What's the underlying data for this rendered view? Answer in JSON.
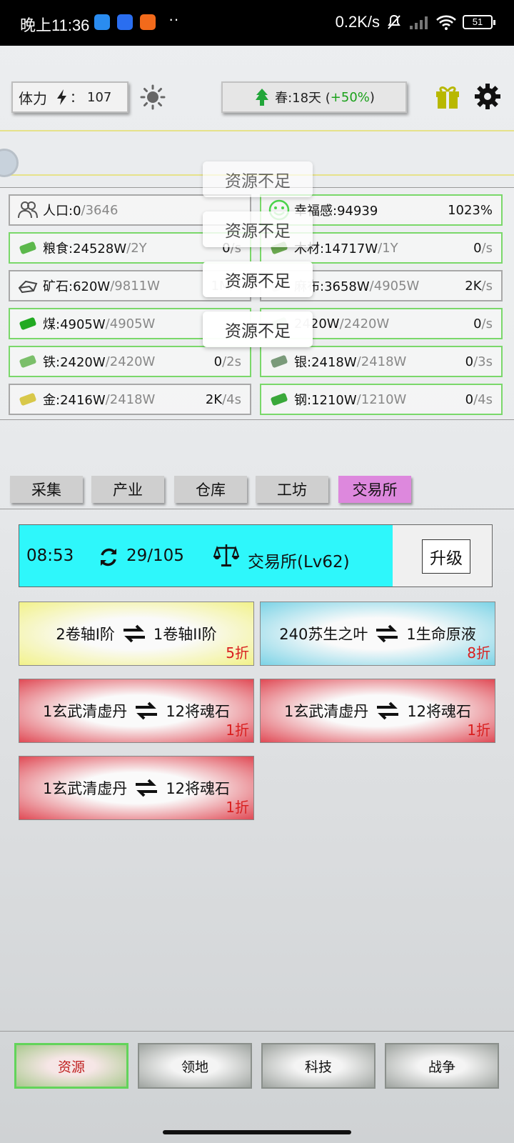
{
  "status_bar": {
    "time": "晚上11:36",
    "dots": "··",
    "net_speed": "0.2K/s",
    "battery": "51"
  },
  "top": {
    "stamina_label": "体力",
    "stamina_sep": "：",
    "stamina_value": "107",
    "season_text": "春:18天 (",
    "season_pct": "+50%",
    "season_close": ")"
  },
  "resources": [
    {
      "name": "人口:0",
      "cap": "/3646",
      "rate": "",
      "unit": "",
      "border": "grey",
      "icon": "people-icon"
    },
    {
      "name": "幸福感:94939",
      "cap": "",
      "rate": "1023%",
      "unit": "",
      "border": "green",
      "icon": "smile-icon"
    },
    {
      "name": "粮食:24528W",
      "cap": "/2Y",
      "rate": "0",
      "unit": "/s",
      "border": "green",
      "icon": "food-icon"
    },
    {
      "name": "木材:14717W",
      "cap": "/1Y",
      "rate": "0",
      "unit": "/s",
      "border": "green",
      "icon": "wood-icon"
    },
    {
      "name": "矿石:620W",
      "cap": "/9811W",
      "rate": "1M",
      "unit": "/s",
      "border": "grey",
      "icon": "ore-icon"
    },
    {
      "name": "麻布:3658W",
      "cap": "/4905W",
      "rate": "2K",
      "unit": "/s",
      "border": "grey",
      "icon": "linen-icon"
    },
    {
      "name": "煤:4905W",
      "cap": "/4905W",
      "rate": "",
      "unit": "",
      "border": "green",
      "icon": "coal-icon"
    },
    {
      "name": "2420W",
      "cap": "/2420W",
      "rate": "0",
      "unit": "/s",
      "border": "green",
      "icon": "copper-icon"
    },
    {
      "name": "铁:2420W",
      "cap": "/2420W",
      "rate": "0",
      "unit": "/2s",
      "border": "green",
      "icon": "iron-icon"
    },
    {
      "name": "银:2418W",
      "cap": "/2418W",
      "rate": "0",
      "unit": "/3s",
      "border": "green",
      "icon": "silver-icon"
    },
    {
      "name": "金:2416W",
      "cap": "/2418W",
      "rate": "2K",
      "unit": "/4s",
      "border": "grey",
      "icon": "gold-icon"
    },
    {
      "name": "钢:1210W",
      "cap": "/1210W",
      "rate": "0",
      "unit": "/4s",
      "border": "green",
      "icon": "steel-icon"
    }
  ],
  "toasts": [
    "资源不足",
    "资源不足",
    "资源不足",
    "资源不足"
  ],
  "tabs": [
    "采集",
    "产业",
    "仓库",
    "工坊",
    "交易所"
  ],
  "exchange": {
    "timer": "08:53",
    "refresh_count": "29/105",
    "title": "交易所(Lv62)",
    "upgrade_label": "升级"
  },
  "trades": [
    {
      "give": "2卷轴I阶",
      "get": "1卷轴II阶",
      "discount": "5折",
      "color": "yellow"
    },
    {
      "give": "240苏生之叶",
      "get": "1生命原液",
      "discount": "8折",
      "color": "blue"
    },
    {
      "give": "1玄武清虚丹",
      "get": "12将魂石",
      "discount": "1折",
      "color": "red"
    },
    {
      "give": "1玄武清虚丹",
      "get": "12将魂石",
      "discount": "1折",
      "color": "red"
    },
    {
      "give": "1玄武清虚丹",
      "get": "12将魂石",
      "discount": "1折",
      "color": "red"
    }
  ],
  "bottom_nav": [
    "资源",
    "领地",
    "科技",
    "战争"
  ]
}
